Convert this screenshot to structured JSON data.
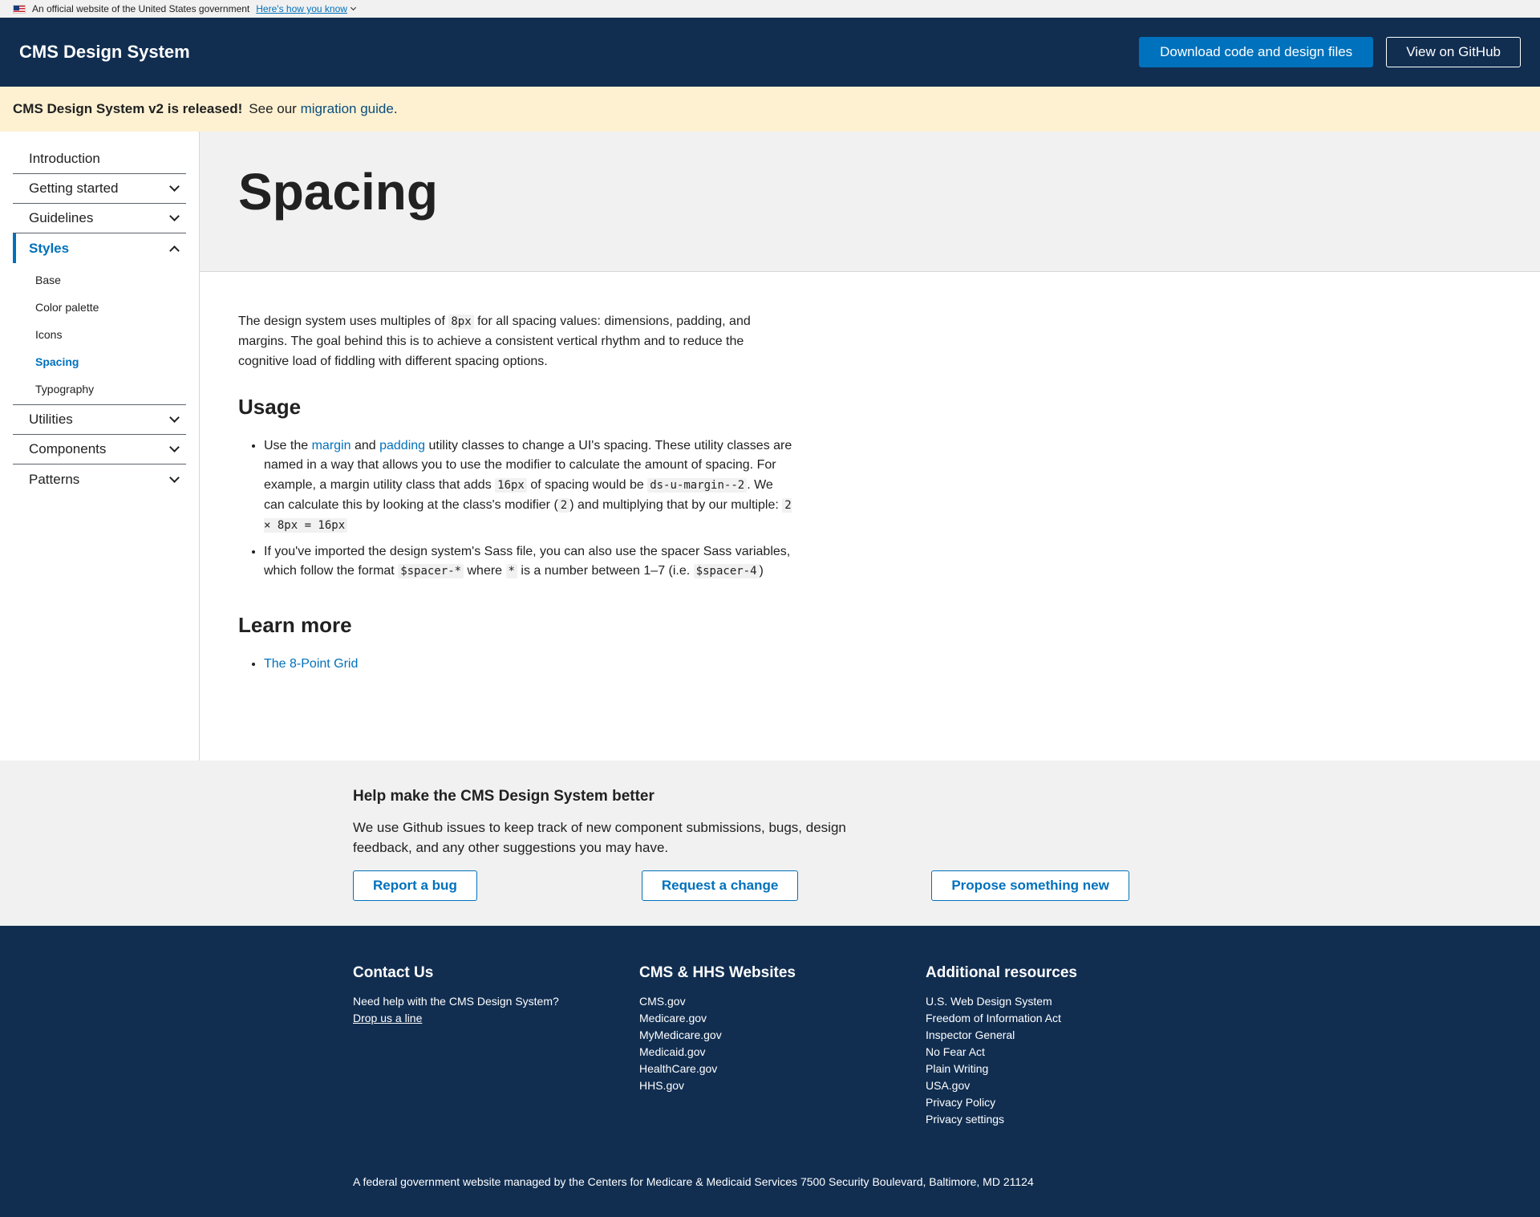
{
  "gov_banner": {
    "text": "An official website of the United States government",
    "link": "Here's how you know"
  },
  "header": {
    "title": "CMS Design System",
    "download_label": "Download code and design files",
    "github_label": "View on GitHub"
  },
  "alert": {
    "strong": "CMS Design System v2 is released!",
    "text_before": "See our",
    "link": "migration guide",
    "text_after": "."
  },
  "sidebar": {
    "items": [
      {
        "label": "Introduction"
      },
      {
        "label": "Getting started"
      },
      {
        "label": "Guidelines"
      },
      {
        "label": "Styles"
      },
      {
        "label": "Utilities"
      },
      {
        "label": "Components"
      },
      {
        "label": "Patterns"
      }
    ],
    "styles_sub": [
      "Base",
      "Color palette",
      "Icons",
      "Spacing",
      "Typography"
    ]
  },
  "main": {
    "title": "Spacing",
    "intro": {
      "t1": "The design system uses multiples of",
      "code": "8px",
      "t2": "for all spacing values: dimensions, padding, and margins. The goal behind this is to achieve a consistent vertical rhythm and to reduce the cognitive load of fiddling with different spacing options."
    },
    "usage_heading": "Usage",
    "usage_1": {
      "t1": "Use the",
      "link1": "margin",
      "t2": "and",
      "link2": "padding",
      "t3": "utility classes to change a UI's spacing. These utility classes are named in a way that allows you to use the modifier to calculate the amount of spacing. For example, a margin utility class that adds",
      "code1": "16px",
      "t4": "of spacing would be",
      "code2": "ds-u-margin--2",
      "t5": ". We can calculate this by looking at the class's modifier (",
      "code3": "2",
      "t6": ") and multiplying that by our multiple:",
      "code4": "2 × 8px = 16px"
    },
    "usage_2": {
      "t1": "If you've imported the design system's Sass file, you can also use the spacer Sass variables, which follow the format",
      "code1": "$spacer-*",
      "t2": "where",
      "code2": "*",
      "t3": "is a number between 1–7 (i.e.",
      "code3": "$spacer-4",
      "t4": ")"
    },
    "learn_heading": "Learn more",
    "learn_link": "The 8-Point Grid"
  },
  "feedback": {
    "title": "Help make the CMS Design System better",
    "text": "We use Github issues to keep track of new component submissions, bugs, design feedback, and any other suggestions you may have.",
    "buttons": [
      "Report a bug",
      "Request a change",
      "Propose something new"
    ]
  },
  "footer": {
    "contact": {
      "title": "Contact Us",
      "text": "Need help with the CMS Design System?",
      "link": "Drop us a line"
    },
    "websites": {
      "title": "CMS & HHS Websites",
      "links": [
        "CMS.gov",
        "Medicare.gov",
        "MyMedicare.gov",
        "Medicaid.gov",
        "HealthCare.gov",
        "HHS.gov"
      ]
    },
    "resources": {
      "title": "Additional resources",
      "links": [
        "U.S. Web Design System",
        "Freedom of Information Act",
        "Inspector General",
        "No Fear Act",
        "Plain Writing",
        "USA.gov",
        "Privacy Policy",
        "Privacy settings"
      ]
    },
    "bottom": "A federal government website managed by the Centers for Medicare & Medicaid Services 7500 Security Boulevard, Baltimore, MD 21124"
  }
}
